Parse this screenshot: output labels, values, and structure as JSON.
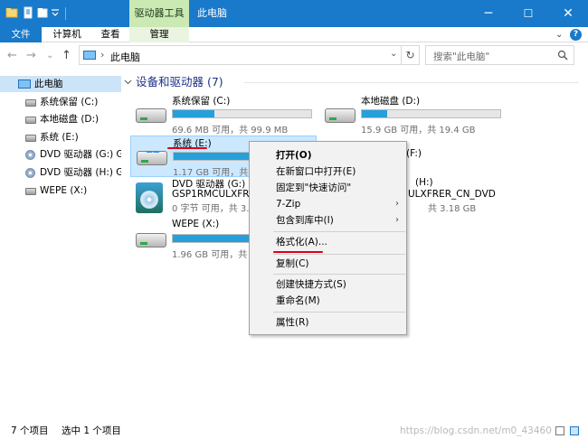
{
  "titlebar": {
    "context_tab": "驱动器工具",
    "title": "此电脑",
    "min": "─",
    "max": "☐",
    "close": "✕"
  },
  "ribbon": {
    "tabs": [
      "文件",
      "计算机",
      "查看",
      "管理"
    ],
    "expand": "⌄",
    "help": "?"
  },
  "address": {
    "back": "←",
    "forward": "→",
    "recent": "⌄",
    "up": "↑",
    "arrow": "›",
    "path": "此电脑",
    "dropdown": "⌄",
    "refresh": "↻",
    "search_placeholder": "搜索\"此电脑\""
  },
  "nav": {
    "root": "此电脑",
    "items": [
      {
        "label": "系统保留 (C:)",
        "icon": "drive-icon"
      },
      {
        "label": "本地磁盘 (D:)",
        "icon": "drive-icon"
      },
      {
        "label": "系统 (E:)",
        "icon": "drive-icon"
      },
      {
        "label": "DVD 驱动器 (G:) G",
        "icon": "dvd-icon"
      },
      {
        "label": "DVD 驱动器 (H:) G",
        "icon": "dvd-icon"
      },
      {
        "label": "WEPE (X:)",
        "icon": "drive-icon"
      }
    ]
  },
  "content": {
    "section_title": "设备和驱动器 (7)",
    "drives": [
      {
        "name": "系统保留 (C:)",
        "caption": "69.6 MB 可用，共 99.9 MB",
        "fill": 0.3
      },
      {
        "name": "本地磁盘 (D:)",
        "caption": "15.9 GB 可用，共 19.4 GB",
        "fill": 0.18
      },
      {
        "name": "系统 (E:)",
        "caption": "1.17 GB 可用，共",
        "fill": 0.96
      },
      {
        "name": "(F:)",
        "caption": "",
        "fill": 0
      },
      {
        "name": "DVD 驱动器 (G:)",
        "name2": "GSP1RMCULXFRE",
        "caption": "0 字节 可用，共 3."
      },
      {
        "name": "(H:)",
        "name2": "ULXFRER_CN_DVD",
        "caption": "共 3.18 GB"
      },
      {
        "name": "WEPE (X:)",
        "caption": "1.96 GB 可用，共",
        "fill": 0.55
      }
    ]
  },
  "context_menu": {
    "items": [
      {
        "label": "打开(O)",
        "bold": true
      },
      {
        "label": "在新窗口中打开(E)"
      },
      {
        "label": "固定到\"快速访问\""
      },
      {
        "label": "7-Zip",
        "submenu": true
      },
      {
        "label": "包含到库中(I)",
        "submenu": true
      },
      {
        "label": "格式化(A)..."
      },
      {
        "label": "复制(C)"
      },
      {
        "label": "创建快捷方式(S)"
      },
      {
        "label": "重命名(M)"
      },
      {
        "label": "属性(R)"
      }
    ],
    "submenu_arrow": "›"
  },
  "status": {
    "count": "7 个项目",
    "selected": "选中 1 个项目",
    "watermark": "https://blog.csdn.net/m0_43460"
  }
}
